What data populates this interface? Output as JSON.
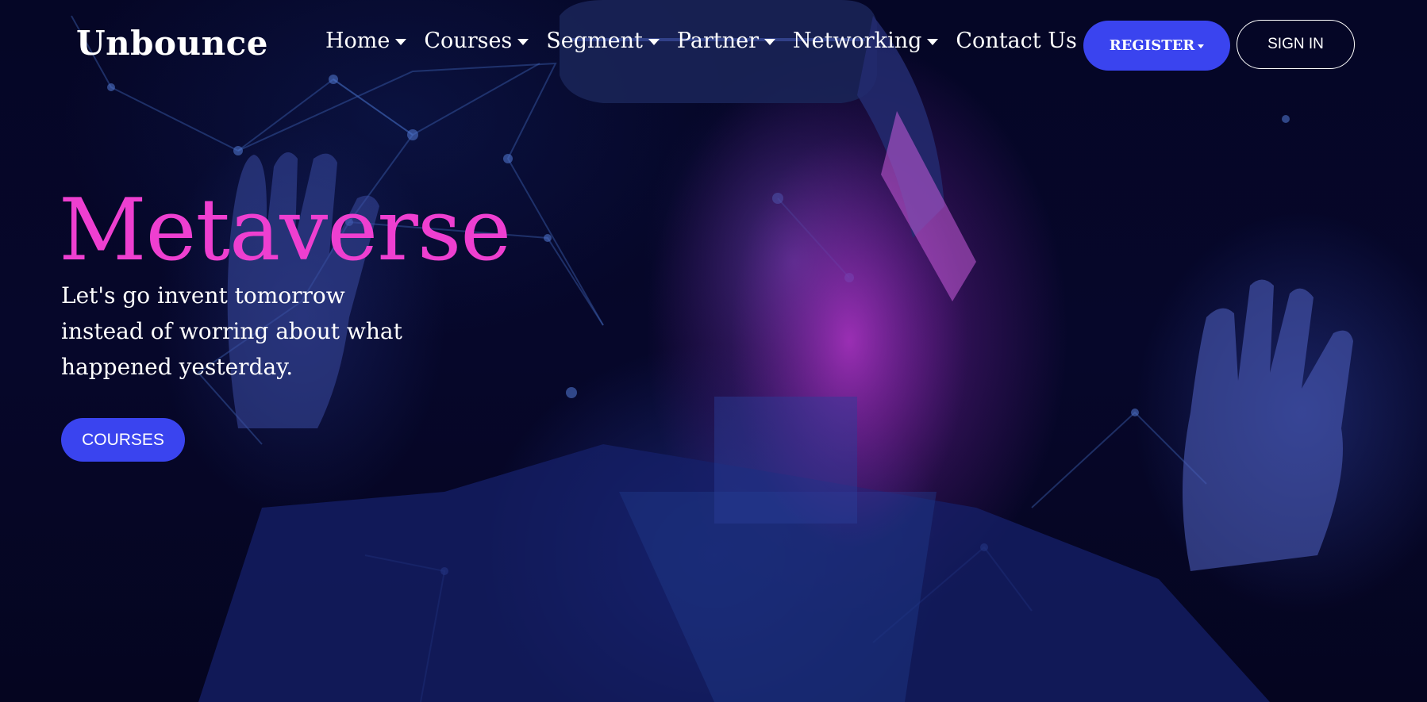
{
  "brand": {
    "logo_text": "Unbounce"
  },
  "nav": {
    "items": [
      {
        "label": "Home",
        "has_dropdown": true
      },
      {
        "label": "Courses",
        "has_dropdown": true
      },
      {
        "label": "Segment",
        "has_dropdown": true
      },
      {
        "label": "Partner",
        "has_dropdown": true
      },
      {
        "label": "Networking",
        "has_dropdown": true
      },
      {
        "label": "Contact Us",
        "has_dropdown": false
      }
    ],
    "register_label": "REGISTER",
    "signin_label": "SIGN IN"
  },
  "hero": {
    "title": "Metaverse",
    "subtitle": "Let's go invent tomorrow instead of worring about what happened yesterday.",
    "cta_label": "COURSES"
  },
  "colors": {
    "accent": "#3a44ef",
    "title_pink": "#ee3fd0",
    "background": "#05061f",
    "text": "#ffffff"
  },
  "icons": {
    "dropdown": "chevron-down-icon"
  }
}
